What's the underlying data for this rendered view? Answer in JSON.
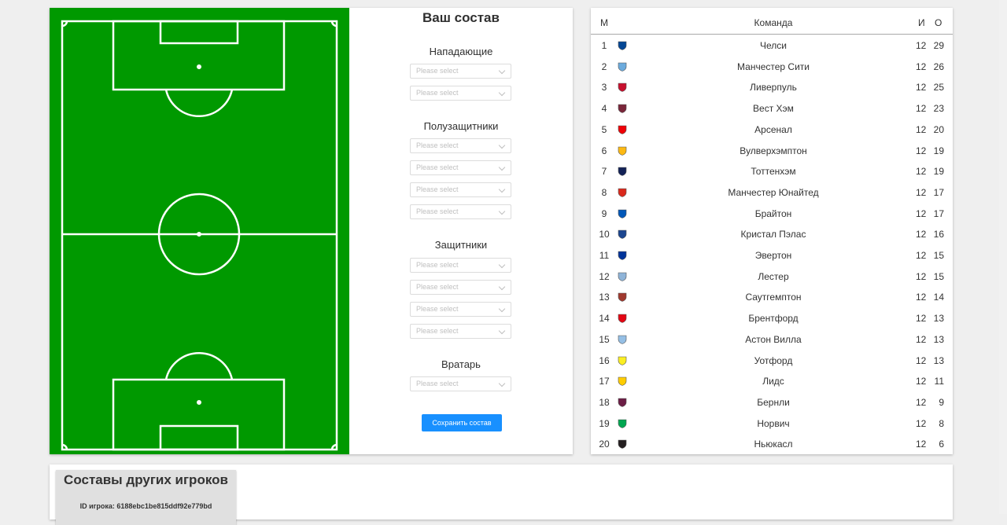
{
  "lineup": {
    "title": "Ваш состав",
    "save_label": "Сохранить состав",
    "groups": {
      "forwards": {
        "title": "Нападающие",
        "placeholders": [
          "Please select",
          "Please select"
        ]
      },
      "midfielders": {
        "title": "Полузащитники",
        "placeholders": [
          "Please select",
          "Please select",
          "Please select",
          "Please select"
        ]
      },
      "defenders": {
        "title": "Защитники",
        "placeholders": [
          "Please select",
          "Please select",
          "Please select",
          "Please select"
        ]
      },
      "goalkeeper": {
        "title": "Вратарь",
        "placeholders": [
          "Please select"
        ]
      }
    }
  },
  "colors": {
    "pitch": "#009900",
    "accent": "#1890ff"
  },
  "table": {
    "headers": {
      "pos": "М",
      "team": "Команда",
      "played": "И",
      "points": "О"
    },
    "rows": [
      {
        "pos": "1",
        "team": "Челси",
        "played": "12",
        "points": "29",
        "crest": "#034694",
        "icon": "chelsea-crest-icon"
      },
      {
        "pos": "2",
        "team": "Манчестер Сити",
        "played": "12",
        "points": "26",
        "crest": "#6cabdd",
        "icon": "man-city-crest-icon"
      },
      {
        "pos": "3",
        "team": "Ливерпуль",
        "played": "12",
        "points": "25",
        "crest": "#c8102e",
        "icon": "liverpool-crest-icon"
      },
      {
        "pos": "4",
        "team": "Вест Хэм",
        "played": "12",
        "points": "23",
        "crest": "#7a263a",
        "icon": "west-ham-crest-icon"
      },
      {
        "pos": "5",
        "team": "Арсенал",
        "played": "12",
        "points": "20",
        "crest": "#ef0107",
        "icon": "arsenal-crest-icon"
      },
      {
        "pos": "6",
        "team": "Вулверхэмптон",
        "played": "12",
        "points": "19",
        "crest": "#fdb913",
        "icon": "wolves-crest-icon"
      },
      {
        "pos": "7",
        "team": "Тоттенхэм",
        "played": "12",
        "points": "19",
        "crest": "#132257",
        "icon": "tottenham-crest-icon"
      },
      {
        "pos": "8",
        "team": "Манчестер Юнайтед",
        "played": "12",
        "points": "17",
        "crest": "#da291c",
        "icon": "man-united-crest-icon"
      },
      {
        "pos": "9",
        "team": "Брайтон",
        "played": "12",
        "points": "17",
        "crest": "#0057b8",
        "icon": "brighton-crest-icon"
      },
      {
        "pos": "10",
        "team": "Кристал Пэлас",
        "played": "12",
        "points": "16",
        "crest": "#1b458f",
        "icon": "crystal-palace-crest-icon"
      },
      {
        "pos": "11",
        "team": "Эвертон",
        "played": "12",
        "points": "15",
        "crest": "#003399",
        "icon": "everton-crest-icon"
      },
      {
        "pos": "12",
        "team": "Лестер",
        "played": "12",
        "points": "15",
        "crest": "#8fb4d8",
        "icon": "leicester-crest-icon"
      },
      {
        "pos": "13",
        "team": "Саутгемптон",
        "played": "12",
        "points": "14",
        "crest": "#a0392e",
        "icon": "southampton-crest-icon"
      },
      {
        "pos": "14",
        "team": "Брентфорд",
        "played": "12",
        "points": "13",
        "crest": "#e30613",
        "icon": "brentford-crest-icon"
      },
      {
        "pos": "15",
        "team": "Астон Вилла",
        "played": "12",
        "points": "13",
        "crest": "#95bfe5",
        "icon": "aston-villa-crest-icon"
      },
      {
        "pos": "16",
        "team": "Уотфорд",
        "played": "12",
        "points": "13",
        "crest": "#fbee23",
        "icon": "watford-crest-icon"
      },
      {
        "pos": "17",
        "team": "Лидс",
        "played": "12",
        "points": "11",
        "crest": "#ffcd00",
        "icon": "leeds-crest-icon"
      },
      {
        "pos": "18",
        "team": "Бернли",
        "played": "12",
        "points": "9",
        "crest": "#6c1d45",
        "icon": "burnley-crest-icon"
      },
      {
        "pos": "19",
        "team": "Норвич",
        "played": "12",
        "points": "8",
        "crest": "#00a650",
        "icon": "norwich-crest-icon"
      },
      {
        "pos": "20",
        "team": "Ньюкасл",
        "played": "12",
        "points": "6",
        "crest": "#241f20",
        "icon": "newcastle-crest-icon"
      }
    ]
  },
  "others": {
    "title": "Составы других игроков",
    "player_id": "ID игрока: 6188ebc1be815ddf92e779bd"
  }
}
